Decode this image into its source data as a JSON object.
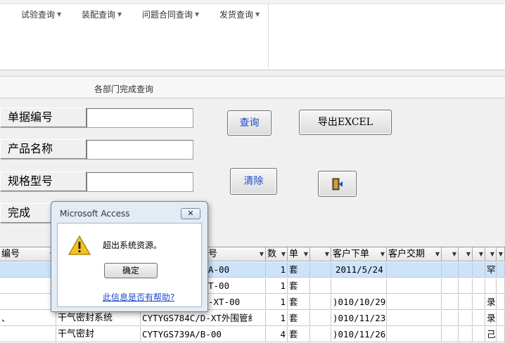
{
  "ribbon": {
    "menus": [
      {
        "label": "试验查询"
      },
      {
        "label": "装配查询"
      },
      {
        "label": "问题合同查询"
      },
      {
        "label": "发货查询"
      }
    ]
  },
  "form": {
    "title": "各部门完成查询",
    "fields": [
      {
        "label": "单据编号",
        "value": ""
      },
      {
        "label": "产品名称",
        "value": ""
      },
      {
        "label": "规格型号",
        "value": ""
      },
      {
        "label": "完成"
      }
    ],
    "buttons": {
      "query": "查询",
      "export": "导出EXCEL",
      "clear": "清除",
      "exit_icon": "exit-door-icon"
    }
  },
  "grid": {
    "headers": [
      "编号",
      "",
      "号",
      "数",
      "单",
      "",
      "客户下单",
      "客户交期",
      "",
      "",
      "",
      "",
      ""
    ],
    "rows": [
      {
        "c1": "",
        "c2": "",
        "c3": "A-00",
        "qty": "1",
        "unit": "套",
        "order": "2011/5/24",
        "mark": "罕"
      },
      {
        "c1": "",
        "c2": "",
        "c3": "T-00",
        "qty": "1",
        "unit": "套",
        "order": "",
        "mark": ""
      },
      {
        "c1": "",
        "c2": "",
        "c3": "-XT-00",
        "qty": "1",
        "unit": "套",
        "order": ")010/10/29",
        "mark": "录"
      },
      {
        "c1": "、",
        "c2": "干气密封系统",
        "c3": "CYTYGS784C/D-XT外围管纟",
        "qty": "1",
        "unit": "套",
        "order": ")010/11/23",
        "mark": "录"
      },
      {
        "c1": "",
        "c2": "干气密封",
        "c3": "CYTYGS739A/B-00",
        "qty": "4",
        "unit": "套",
        "order": ")010/11/26",
        "mark": "己"
      }
    ]
  },
  "dialog": {
    "title": "Microsoft Access",
    "message": "超出系统资源。",
    "ok": "确定",
    "help": "此信息是否有帮助?",
    "icon": "warning-icon"
  },
  "colors": {
    "link_blue": "#1f49c8",
    "selected_row": "#cde3fb"
  }
}
